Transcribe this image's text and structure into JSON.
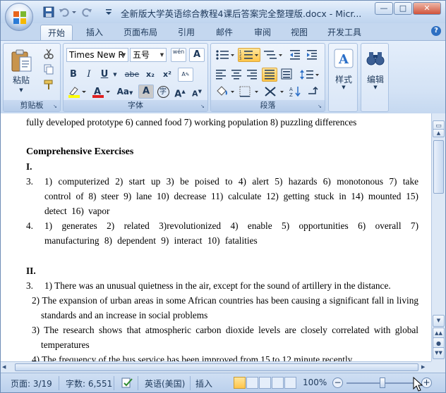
{
  "window": {
    "title": "全新版大学英语综合教程4课后答案完全整理版.docx - Micr...",
    "minimize": "—",
    "maximize": "□",
    "close": "✕"
  },
  "tabs": [
    "开始",
    "插入",
    "页面布局",
    "引用",
    "邮件",
    "审阅",
    "视图",
    "开发工具"
  ],
  "ribbon": {
    "clipboard": {
      "group_label": "剪贴板",
      "paste": "粘贴"
    },
    "font": {
      "group_label": "字体",
      "font_name": "Times New R",
      "font_size": "五号",
      "phonetic": "wén",
      "bold": "B",
      "italic": "I",
      "underline": "U",
      "strike": "abe",
      "subscript": "x₂",
      "superscript": "x²",
      "change_case": "Aa",
      "shade": "A",
      "circle": "字",
      "grow": "A",
      "shrink": "A"
    },
    "paragraph": {
      "group_label": "段落"
    },
    "styles": {
      "label": "样式"
    },
    "editing": {
      "label": "编辑"
    }
  },
  "document": {
    "top_line": "fully developed prototype    6) canned food    7) working population    8) puzzling differences",
    "heading": "Comprehensive Exercises",
    "section1": "I.",
    "i3_num": "3.",
    "i3_text": "1) computerized  2) start up  3) be poised to 4) alert 5) hazards 6) monotonous 7) take control of  8) steer  9) lane  10) decrease  11) calculate  12) getting stuck in  14) mounted  15) detect  16) vapor",
    "i4_num": "4.",
    "i4_text": "1) generates  2) related  3)revolutionized  4) enable  5) opportunities  6) overall  7) manufacturing  8) dependent  9) interact  10) fatalities",
    "section2": "II.",
    "ii3_num": "3.",
    "ii3_1": "1) There was an unusual quietness in the air, except for the sound of artillery in the distance.",
    "ii3_2": "2) The expansion of urban areas in some African countries has been causing a significant fall in living standards and an increase in social problems",
    "ii3_3": "3) The research shows that atmospheric carbon dioxide levels are closely correlated with global temperatures",
    "ii3_4": "4) The frequency of the bus service has been improved from 15 to 12 minute recently."
  },
  "status": {
    "page": "页面: 3/19",
    "words": "字数: 6,551",
    "language": "英语(美国)",
    "mode": "插入",
    "zoom": "100%",
    "zoom_minus": "−",
    "zoom_plus": "+"
  }
}
